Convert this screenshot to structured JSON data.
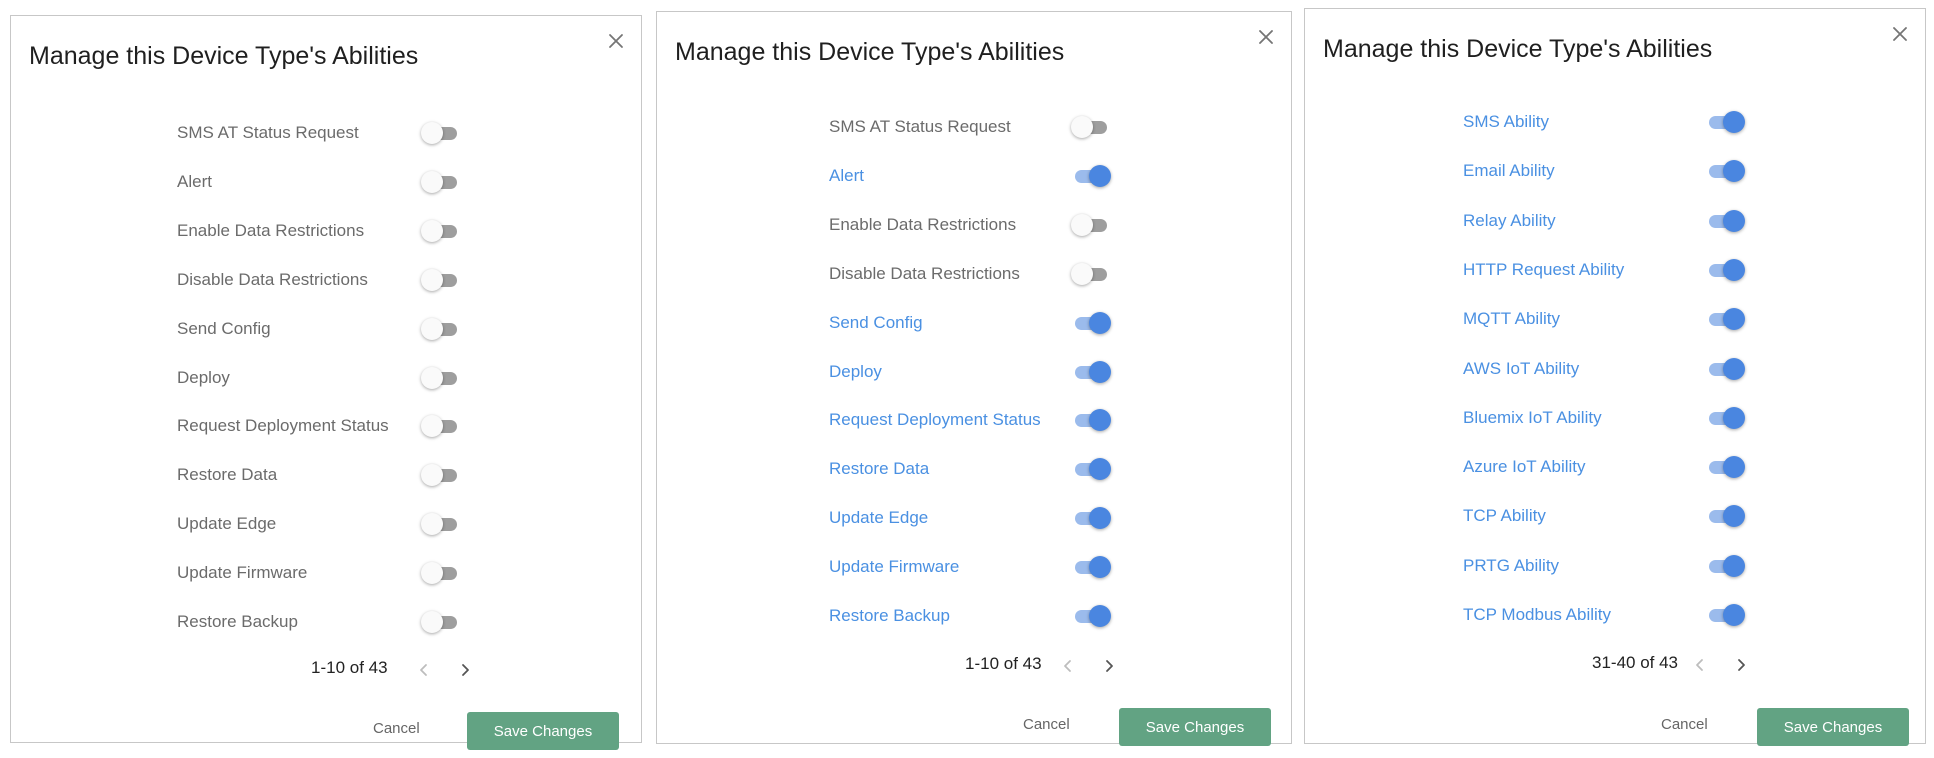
{
  "panels": [
    {
      "title": "Manage this Device Type's Abilities",
      "items": [
        {
          "label": "SMS AT Status Request",
          "enabled": false
        },
        {
          "label": "Alert",
          "enabled": false
        },
        {
          "label": "Enable Data Restrictions",
          "enabled": false
        },
        {
          "label": "Disable Data Restrictions",
          "enabled": false
        },
        {
          "label": "Send Config",
          "enabled": false
        },
        {
          "label": "Deploy",
          "enabled": false
        },
        {
          "label": "Request Deployment Status",
          "enabled": false
        },
        {
          "label": "Restore Data",
          "enabled": false
        },
        {
          "label": "Update Edge",
          "enabled": false
        },
        {
          "label": "Update Firmware",
          "enabled": false
        },
        {
          "label": "Restore Backup",
          "enabled": false
        }
      ],
      "pagination": "1-10 of 43",
      "cancel_label": "Cancel",
      "save_label": "Save Changes"
    },
    {
      "title": "Manage this Device Type's Abilities",
      "items": [
        {
          "label": "SMS AT Status Request",
          "enabled": false
        },
        {
          "label": "Alert",
          "enabled": true
        },
        {
          "label": "Enable Data Restrictions",
          "enabled": false
        },
        {
          "label": "Disable Data Restrictions",
          "enabled": false
        },
        {
          "label": "Send Config",
          "enabled": true
        },
        {
          "label": "Deploy",
          "enabled": true
        },
        {
          "label": "Request Deployment Status",
          "enabled": true
        },
        {
          "label": "Restore Data",
          "enabled": true
        },
        {
          "label": "Update Edge",
          "enabled": true
        },
        {
          "label": "Update Firmware",
          "enabled": true
        },
        {
          "label": "Restore Backup",
          "enabled": true
        }
      ],
      "pagination": "1-10 of 43",
      "cancel_label": "Cancel",
      "save_label": "Save Changes"
    },
    {
      "title": "Manage this Device Type's Abilities",
      "items": [
        {
          "label": "SMS Ability",
          "enabled": true
        },
        {
          "label": "Email Ability",
          "enabled": true
        },
        {
          "label": "Relay Ability",
          "enabled": true
        },
        {
          "label": "HTTP Request Ability",
          "enabled": true
        },
        {
          "label": "MQTT Ability",
          "enabled": true
        },
        {
          "label": "AWS IoT Ability",
          "enabled": true
        },
        {
          "label": "Bluemix IoT Ability",
          "enabled": true
        },
        {
          "label": "Azure IoT Ability",
          "enabled": true
        },
        {
          "label": "TCP Ability",
          "enabled": true
        },
        {
          "label": "PRTG Ability",
          "enabled": true
        },
        {
          "label": "TCP Modbus Ability",
          "enabled": true
        }
      ],
      "pagination": "31-40 of 43",
      "cancel_label": "Cancel",
      "save_label": "Save Changes"
    }
  ],
  "icons": {
    "close": "close-icon",
    "prev": "chevron-left-icon",
    "next": "chevron-right-icon"
  },
  "colors": {
    "label_enabled": "#4a90e2",
    "label_disabled": "#6b6b6b",
    "toggle_on": "#4a86e0",
    "save_button": "#62a383"
  }
}
